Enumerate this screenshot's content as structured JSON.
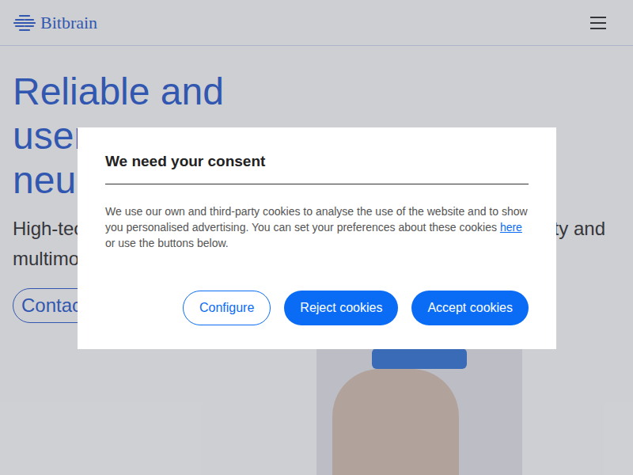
{
  "header": {
    "logo": "Bitbrain"
  },
  "hero": {
    "heading_lines": [
      "Reliable and",
      "user",
      "neur"
    ],
    "paragraph_left": [
      "High-tec",
      "multimo"
    ],
    "paragraph_right": "ty and",
    "button": "Contac"
  },
  "consent": {
    "title": "We need your consent",
    "text_before": "We use our own and third-party cookies to analyse the use of the website and to show you personalised advertising. You can set your preferences about these cookies ",
    "link": "here",
    "text_after": " or use the buttons below.",
    "buttons": [
      {
        "label": "Configure",
        "kind": "outline"
      },
      {
        "label": "Reject cookies",
        "kind": "solid"
      },
      {
        "label": "Accept cookies",
        "kind": "solid"
      }
    ]
  }
}
